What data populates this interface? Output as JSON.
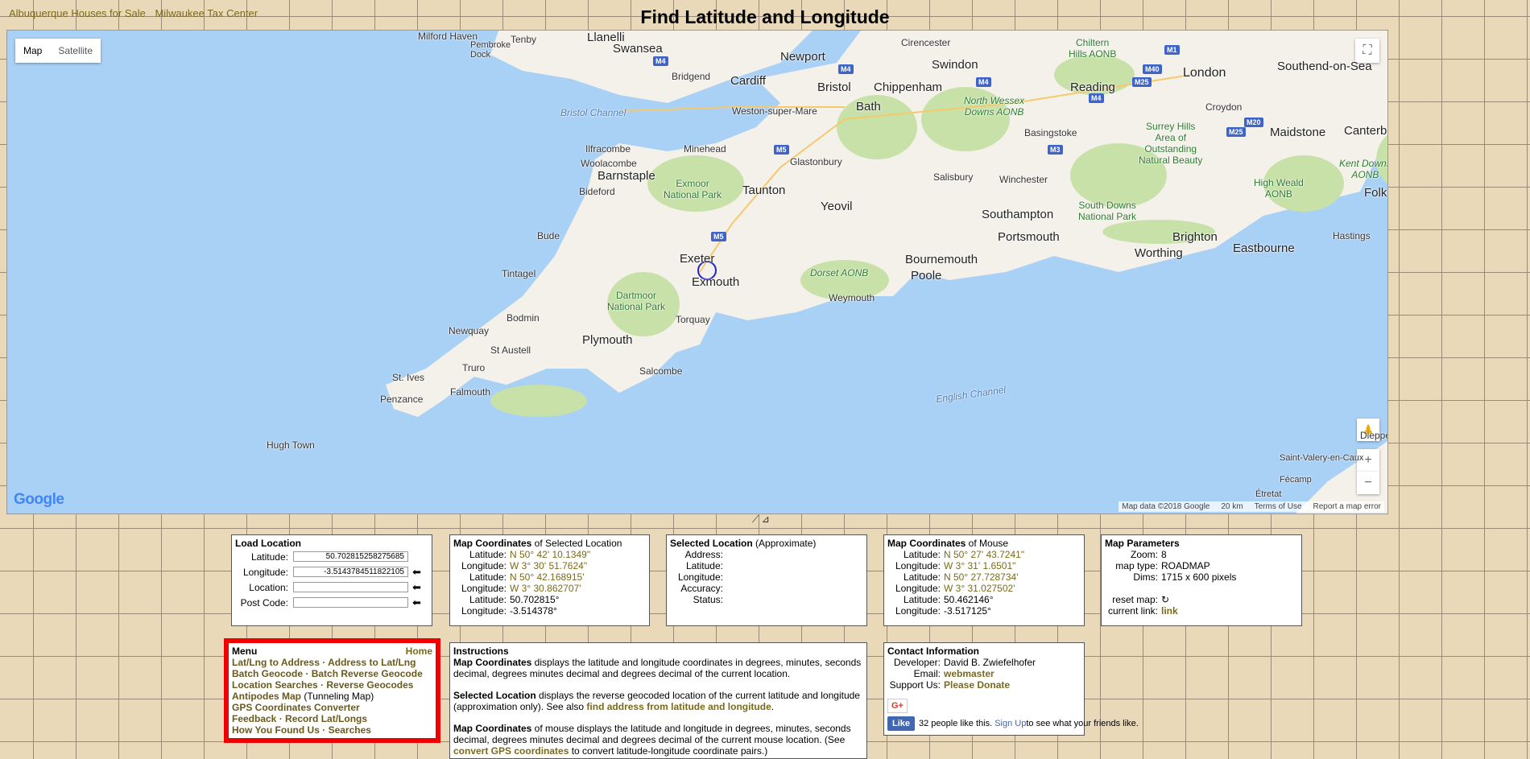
{
  "top_links": [
    "Albuquerque Houses for Sale",
    "Milwaukee Tax Center"
  ],
  "title": "Find Latitude and Longitude",
  "map": {
    "type_buttons": [
      "Map",
      "Satellite"
    ],
    "logo": "Google",
    "attribution": [
      "Map data ©2018 Google",
      "20 km",
      "Terms of Use",
      "Report a map error"
    ],
    "labels": {
      "milford_haven": "Milford Haven",
      "tenby": "Tenby",
      "llanelli": "Llanelli",
      "swansea": "Swansea",
      "pembroke": "Pembroke\nDock",
      "newport": "Newport",
      "cardiff": "Cardiff",
      "bridgend": "Bridgend",
      "cirencester": "Cirencester",
      "chiltern": "Chiltern\nHills AONB",
      "swindon": "Swindon",
      "london": "London",
      "southend": "Southend-on-Sea",
      "bristol": "Bristol",
      "chippenham": "Chippenham",
      "reading": "Reading",
      "bristol_channel": "Bristol Channel",
      "weston": "Weston-super-Mare",
      "bath": "Bath",
      "north_wessex": "North Wessex\nDowns AONB",
      "croydon": "Croydon",
      "maidstone": "Maidstone",
      "canterbury": "Canterbu",
      "basingstoke": "Basingstoke",
      "surrey": "Surrey Hills\nArea of\nOutstanding\nNatural Beauty",
      "ilfracombe": "Ilfracombe",
      "minehead": "Minehead",
      "woolacombe": "Woolacombe",
      "barnstaple": "Barnstaple",
      "glastonbury": "Glastonbury",
      "salisbury": "Salisbury",
      "winchester": "Winchester",
      "kent": "Kent Downs\nAONB",
      "bideford": "Bideford",
      "exmoor": "Exmoor\nNational Park",
      "taunton": "Taunton",
      "yeovil": "Yeovil",
      "southampton": "Southampton",
      "high_weald": "High Weald\nAONB",
      "folkestone": "Folkes",
      "bude": "Bude",
      "south_downs": "South Downs\nNational Park",
      "portsmouth": "Portsmouth",
      "brighton": "Brighton",
      "hastings": "Hastings",
      "exeter": "Exeter",
      "worthing": "Worthing",
      "eastbourne": "Eastbourne",
      "bournemouth": "Bournemouth",
      "tintagel": "Tintagel",
      "exmouth": "Exmouth",
      "dorset": "Dorset AONB",
      "poole": "Poole",
      "dartmoor": "Dartmoor\nNational Park",
      "weymouth": "Weymouth",
      "bodmin": "Bodmin",
      "torquay": "Torquay",
      "newquay": "Newquay",
      "st_austell": "St Austell",
      "plymouth": "Plymouth",
      "truro": "Truro",
      "st_ives": "St. Ives",
      "salcombe": "Salcombe",
      "penzance": "Penzance",
      "falmouth": "Falmouth",
      "english_channel": "English Channel",
      "hugh_town": "Hugh Town",
      "dieppe": "Dieppe",
      "saint_valery": "Saint-Valery-en-Caux",
      "fecamp": "Fécamp",
      "etretat": "Étretat"
    },
    "roads": [
      "M4",
      "M4",
      "M1",
      "M40",
      "M4",
      "M4",
      "M25",
      "M25",
      "M20",
      "M4",
      "M5",
      "M3",
      "M5"
    ]
  },
  "load_location": {
    "title": "Load Location",
    "latitude_label": "Latitude:",
    "latitude_value": "50.702815258275685",
    "longitude_label": "Longitude:",
    "longitude_value": "-3.5143784511822105",
    "location_label": "Location:",
    "location_value": "",
    "postcode_label": "Post Code:",
    "postcode_value": ""
  },
  "selected_coords": {
    "title_bold": "Map Coordinates",
    "title_rest": " of Selected Location",
    "rows": [
      {
        "k": "Latitude:",
        "v": "N 50° 42' 10.1349\"",
        "dms": true
      },
      {
        "k": "Longitude:",
        "v": "W 3° 30' 51.7624\"",
        "dms": true
      },
      {
        "k": "Latitude:",
        "v": "N 50° 42.168915'",
        "dms": true
      },
      {
        "k": "Longitude:",
        "v": "W 3° 30.862707'",
        "dms": true
      },
      {
        "k": "Latitude:",
        "v": "50.702815°",
        "dms": false
      },
      {
        "k": "Longitude:",
        "v": "-3.514378°",
        "dms": false
      }
    ]
  },
  "selected_location": {
    "title_bold": "Selected Location",
    "title_rest": " (Approximate)",
    "rows": [
      "Address:",
      "Latitude:",
      "Longitude:",
      "Accuracy:",
      "Status:"
    ]
  },
  "mouse_coords": {
    "title_bold": "Map Coordinates",
    "title_rest": " of Mouse",
    "rows": [
      {
        "k": "Latitude:",
        "v": "N 50° 27' 43.7241\"",
        "dms": true
      },
      {
        "k": "Longitude:",
        "v": "W 3° 31' 1.6501\"",
        "dms": true
      },
      {
        "k": "Latitude:",
        "v": "N 50° 27.728734'",
        "dms": true
      },
      {
        "k": "Longitude:",
        "v": "W 3° 31.027502'",
        "dms": true
      },
      {
        "k": "Latitude:",
        "v": "50.462146°",
        "dms": false
      },
      {
        "k": "Longitude:",
        "v": "-3.517125°",
        "dms": false
      }
    ]
  },
  "map_params": {
    "title": "Map Parameters",
    "zoom_label": "Zoom:",
    "zoom": "8",
    "type_label": "map type:",
    "type": "ROADMAP",
    "dims_label": "Dims:",
    "dims": "1715 x 600 pixels",
    "reset_label": "reset map:",
    "link_label": "current link:",
    "link": "link"
  },
  "menu": {
    "title": "Menu",
    "home": "Home",
    "items": [
      [
        "Lat/Lng to Address",
        " · ",
        "Address to Lat/Lng"
      ],
      [
        "Batch Geocode",
        " · ",
        "Batch Reverse Geocode"
      ],
      [
        "Location Searches",
        " · ",
        "Reverse Geocodes"
      ],
      [
        "Antipodes Map",
        " (Tunneling Map)",
        ""
      ],
      [
        "GPS Coordinates Converter",
        "",
        ""
      ],
      [
        "Feedback",
        " · ",
        "Record Lat/Longs"
      ],
      [
        "How You Found Us",
        " · ",
        "Searches"
      ]
    ]
  },
  "instructions": {
    "title": "Instructions",
    "p1_bold": "Map Coordinates",
    "p1_text": " displays the latitude and longitude coordinates in degrees, minutes, seconds decimal, degrees minutes decimal and degrees decimal of the current location.",
    "p2_bold": "Selected Location",
    "p2_text": " displays the reverse geocoded location of the current latitude and longitude (approximation only). See also ",
    "p2_link": "find address from latitude and longitude",
    "p2_end": ".",
    "p3_bold": "Map Coordinates",
    "p3_text": " of mouse displays the latitude and longitude in degrees, minutes, seconds decimal, degrees minutes decimal and degrees decimal of the current mouse location. (See ",
    "p3_link": "convert GPS coordinates",
    "p3_end": " to convert latitude-longitude coordinate pairs.)"
  },
  "contact": {
    "title": "Contact Information",
    "dev_label": "Developer:",
    "dev": "David B. Zwiefelhofer",
    "email_label": "Email:",
    "email": "webmaster",
    "support_label": "Support Us:",
    "support": "Please Donate",
    "gplus": "G+",
    "fb_like": "Like",
    "fb_text": "32 people like this.",
    "fb_signup": "Sign Up",
    "fb_rest": " to see what your friends like."
  }
}
